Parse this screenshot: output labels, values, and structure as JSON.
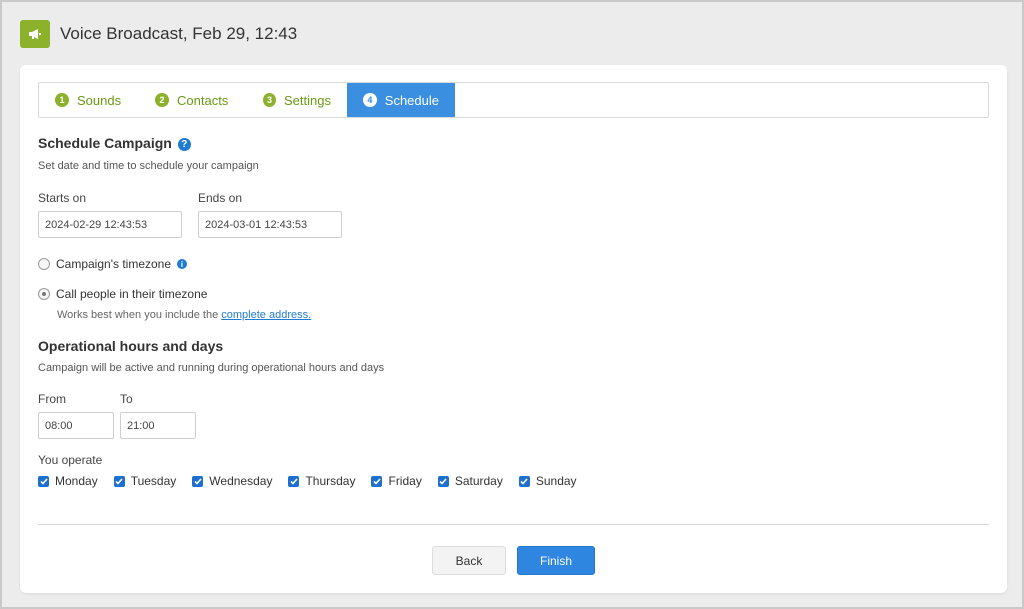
{
  "window": {
    "title": "Voice Broadcast, Feb 29, 12:43",
    "icon": "megaphone-icon",
    "brand_color": "#8cb12b",
    "accent_color": "#3a8fe0"
  },
  "tabs": [
    {
      "num": "1",
      "label": "Sounds",
      "active": false
    },
    {
      "num": "2",
      "label": "Contacts",
      "active": false
    },
    {
      "num": "3",
      "label": "Settings",
      "active": false
    },
    {
      "num": "4",
      "label": "Schedule",
      "active": true
    }
  ],
  "schedule": {
    "title": "Schedule Campaign",
    "help_icon": "question-icon",
    "description": "Set date and time to schedule your campaign",
    "starts_label": "Starts on",
    "starts_value": "2024-02-29 12:43:53",
    "ends_label": "Ends on",
    "ends_value": "2024-03-01 12:43:53",
    "timezone_options": [
      {
        "label": "Campaign's timezone",
        "checked": false
      },
      {
        "label": "Call people in their timezone",
        "checked": true
      }
    ],
    "hint_text": "Works best when you include the ",
    "hint_link": "complete address."
  },
  "operational": {
    "title": "Operational hours and days",
    "description": "Campaign will be active and running during operational hours and days",
    "from_label": "From",
    "from_value": "08:00",
    "to_label": "To",
    "to_value": "21:00",
    "operate_label": "You operate",
    "days": [
      {
        "label": "Monday",
        "checked": true
      },
      {
        "label": "Tuesday",
        "checked": true
      },
      {
        "label": "Wednesday",
        "checked": true
      },
      {
        "label": "Thursday",
        "checked": true
      },
      {
        "label": "Friday",
        "checked": true
      },
      {
        "label": "Saturday",
        "checked": true
      },
      {
        "label": "Sunday",
        "checked": true
      }
    ]
  },
  "footer": {
    "back_label": "Back",
    "finish_label": "Finish"
  }
}
